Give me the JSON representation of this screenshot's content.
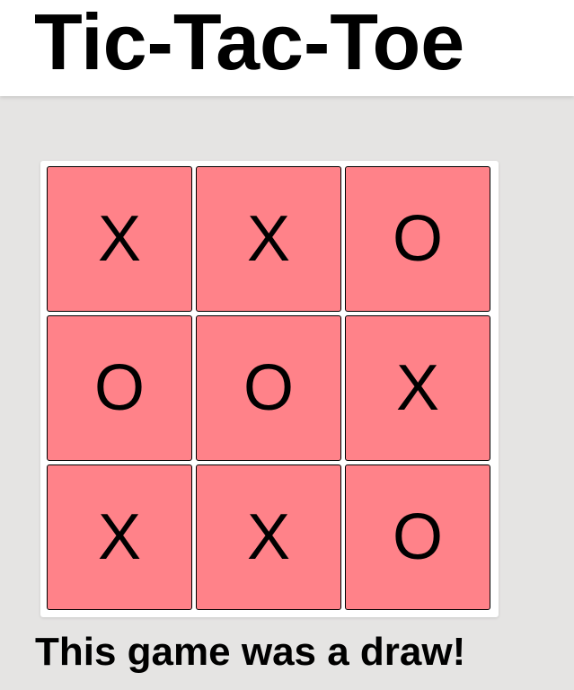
{
  "header": {
    "title": "Tic-Tac-Toe"
  },
  "board": {
    "cells": [
      "X",
      "X",
      "O",
      "O",
      "O",
      "X",
      "X",
      "X",
      "O"
    ]
  },
  "status": {
    "message": "This game was a draw!"
  },
  "colors": {
    "page_background": "#e5e4e3",
    "cell_background": "#ff8289",
    "board_background": "#ffffff"
  }
}
